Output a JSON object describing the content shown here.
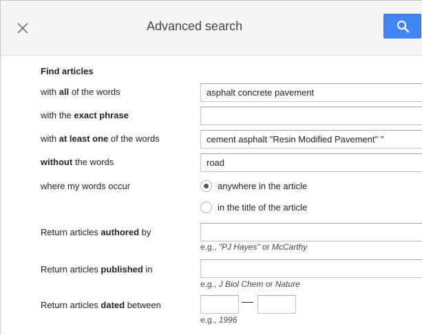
{
  "header": {
    "title": "Advanced search"
  },
  "find": {
    "section_title": "Find articles",
    "all_words": {
      "label_pre": "with ",
      "label_bold": "all",
      "label_post": " of the words",
      "value": "asphalt concrete pavement"
    },
    "exact_phrase": {
      "label_pre": "with the ",
      "label_bold": "exact phrase",
      "label_post": "",
      "value": ""
    },
    "at_least_one": {
      "label_pre": "with ",
      "label_bold": "at least one",
      "label_post": " of the words",
      "value": "cement asphalt \"Resin Modified Pavement\" \""
    },
    "without": {
      "label_pre": "",
      "label_bold": "without",
      "label_post": " the words",
      "value": "road"
    },
    "occur": {
      "label": "where my words occur",
      "options": [
        {
          "label": "anywhere in the article",
          "selected": true
        },
        {
          "label": "in the title of the article",
          "selected": false
        }
      ]
    }
  },
  "authored": {
    "label_pre": "Return articles ",
    "label_bold": "authored",
    "label_post": " by",
    "value": "",
    "hint_pre": "e.g., ",
    "hint_em1": "\"PJ Hayes\"",
    "hint_mid": " or ",
    "hint_em2": "McCarthy"
  },
  "published": {
    "label_pre": "Return articles ",
    "label_bold": "published",
    "label_post": " in",
    "value": "",
    "hint_pre": "e.g., ",
    "hint_em1": "J Biol Chem",
    "hint_mid": " or ",
    "hint_em2": "Nature"
  },
  "dated": {
    "label_pre": "Return articles ",
    "label_bold": "dated",
    "label_post": " between",
    "from": "",
    "to": "",
    "hint_pre": "e.g., ",
    "hint_em": "1996"
  },
  "colors": {
    "accent": "#4285f4",
    "header_bg": "#f5f5f5"
  },
  "icons": {
    "close": "close-icon",
    "search": "search-icon",
    "radio_on": "radio-selected",
    "radio_off": "radio-unselected"
  }
}
